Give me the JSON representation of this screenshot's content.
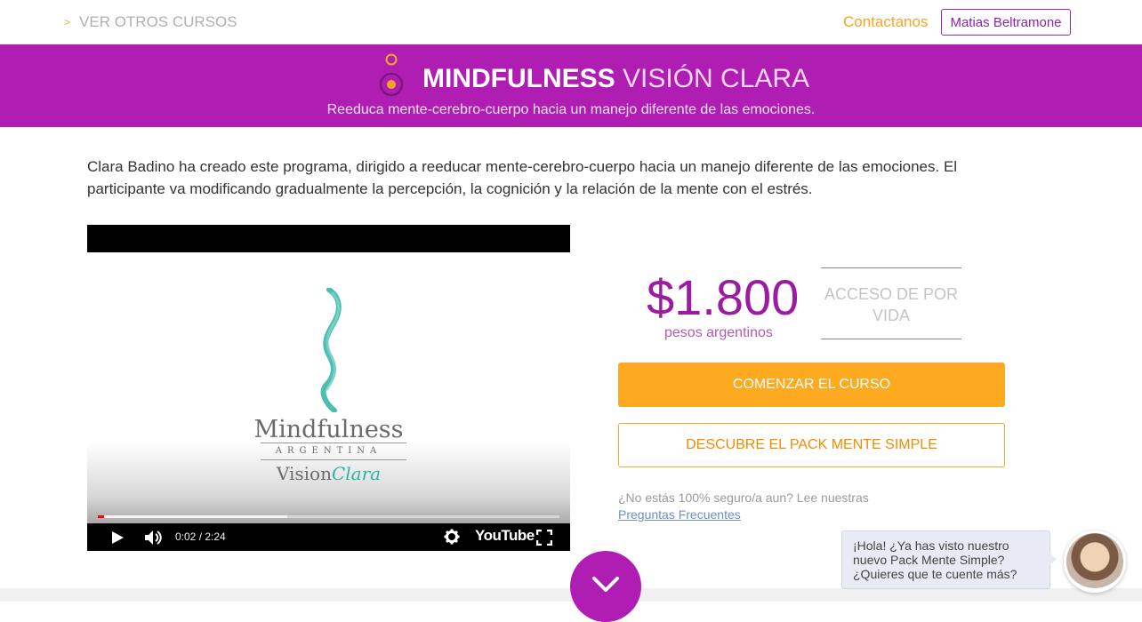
{
  "topbar": {
    "back_arrow": ">",
    "back_label": "VER OTROS CURSOS",
    "contact_label": "Contactanos",
    "user_name": "Matias Beltramone"
  },
  "hero": {
    "title_strong": "MINDFULNESS",
    "title_light": "VISIÓN CLARA",
    "subtitle": "Reeduca mente-cerebro-cuerpo hacia un manejo diferente de las emociones."
  },
  "intro": {
    "text": "Clara Badino ha creado este programa, dirigido a reeducar mente-cerebro-cuerpo hacia un manejo diferente de las emociones. El participante va modificando gradualmente la percepción, la cognición y la relación de la mente con el estrés."
  },
  "video": {
    "brand_main": "Mindfulness",
    "brand_country": "ARGENTINA",
    "brand_vision": "Vision",
    "brand_clara": "Clara",
    "time": "0:02 / 2:24",
    "played_fraction": 0.014,
    "buffered_fraction": 0.41,
    "youtube_label": "YouTube"
  },
  "pricing": {
    "price": "$1.800",
    "unit": "pesos argentinos",
    "access": "ACCESO DE POR VIDA"
  },
  "actions": {
    "start_label": "COMENZAR EL CURSO",
    "pack_label": "DESCUBRE EL PACK MENTE SIMPLE"
  },
  "faq": {
    "text": "¿No estás 100% seguro/a aun? Lee nuestras",
    "link": "Preguntas Frecuentes"
  },
  "chat": {
    "message": "¡Hola! ¿Ya has visto nuestro nuevo Pack Mente Simple? ¿Quieres que te cuente más?"
  },
  "colors": {
    "brand_purple": "#b01db3",
    "accent_orange": "#fdaa20",
    "teal": "#2bb3a3"
  }
}
